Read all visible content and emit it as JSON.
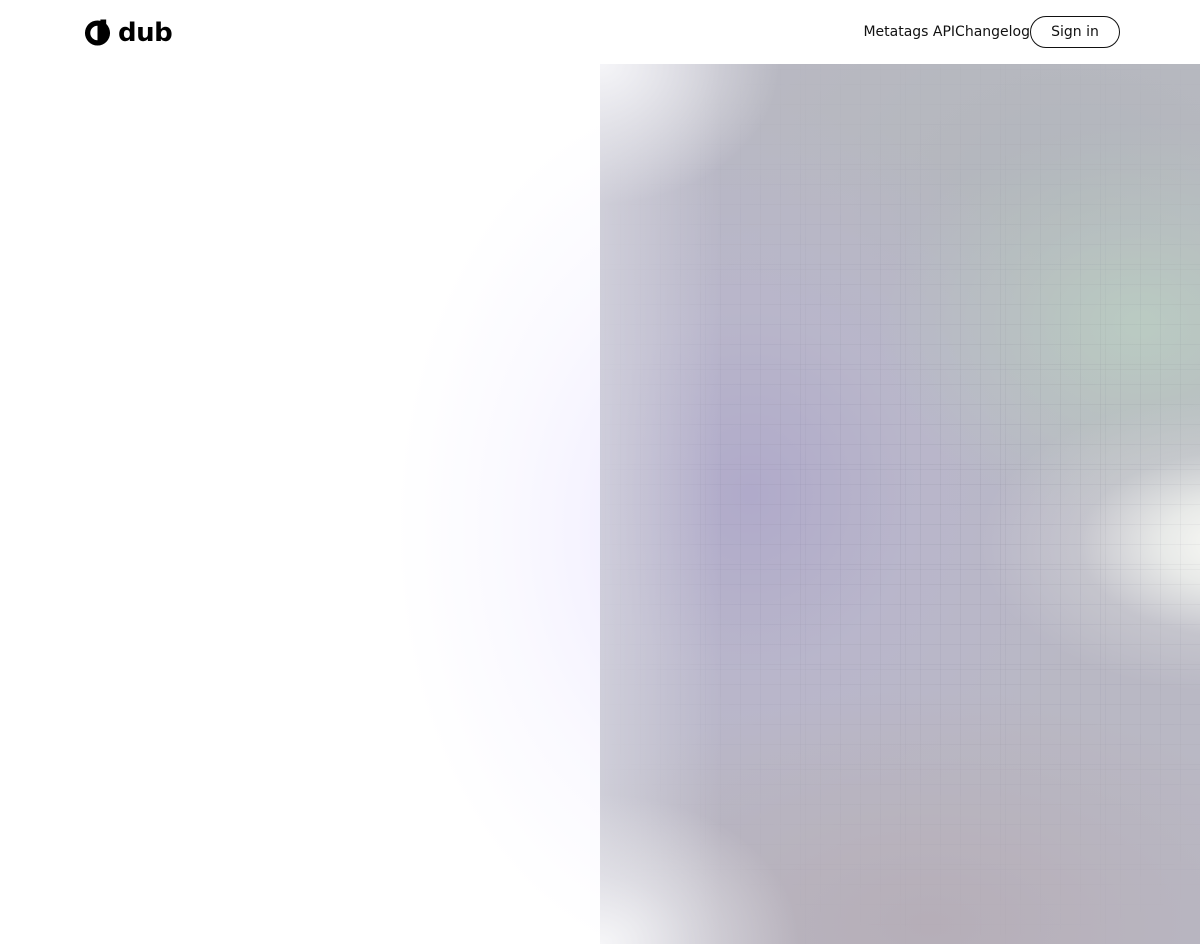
{
  "header": {
    "logo_text": "dub",
    "logo_icon": "dub-logo-icon",
    "nav": [
      {
        "label": "Metatags API"
      },
      {
        "label": "Changelog"
      }
    ],
    "signin_label": "Sign in"
  },
  "colors": {
    "background": "#ffffff",
    "text": "#111111",
    "panel_purple": "#b0aaca",
    "panel_green": "#bacdc2",
    "panel_grey": "#b2b6bc"
  }
}
